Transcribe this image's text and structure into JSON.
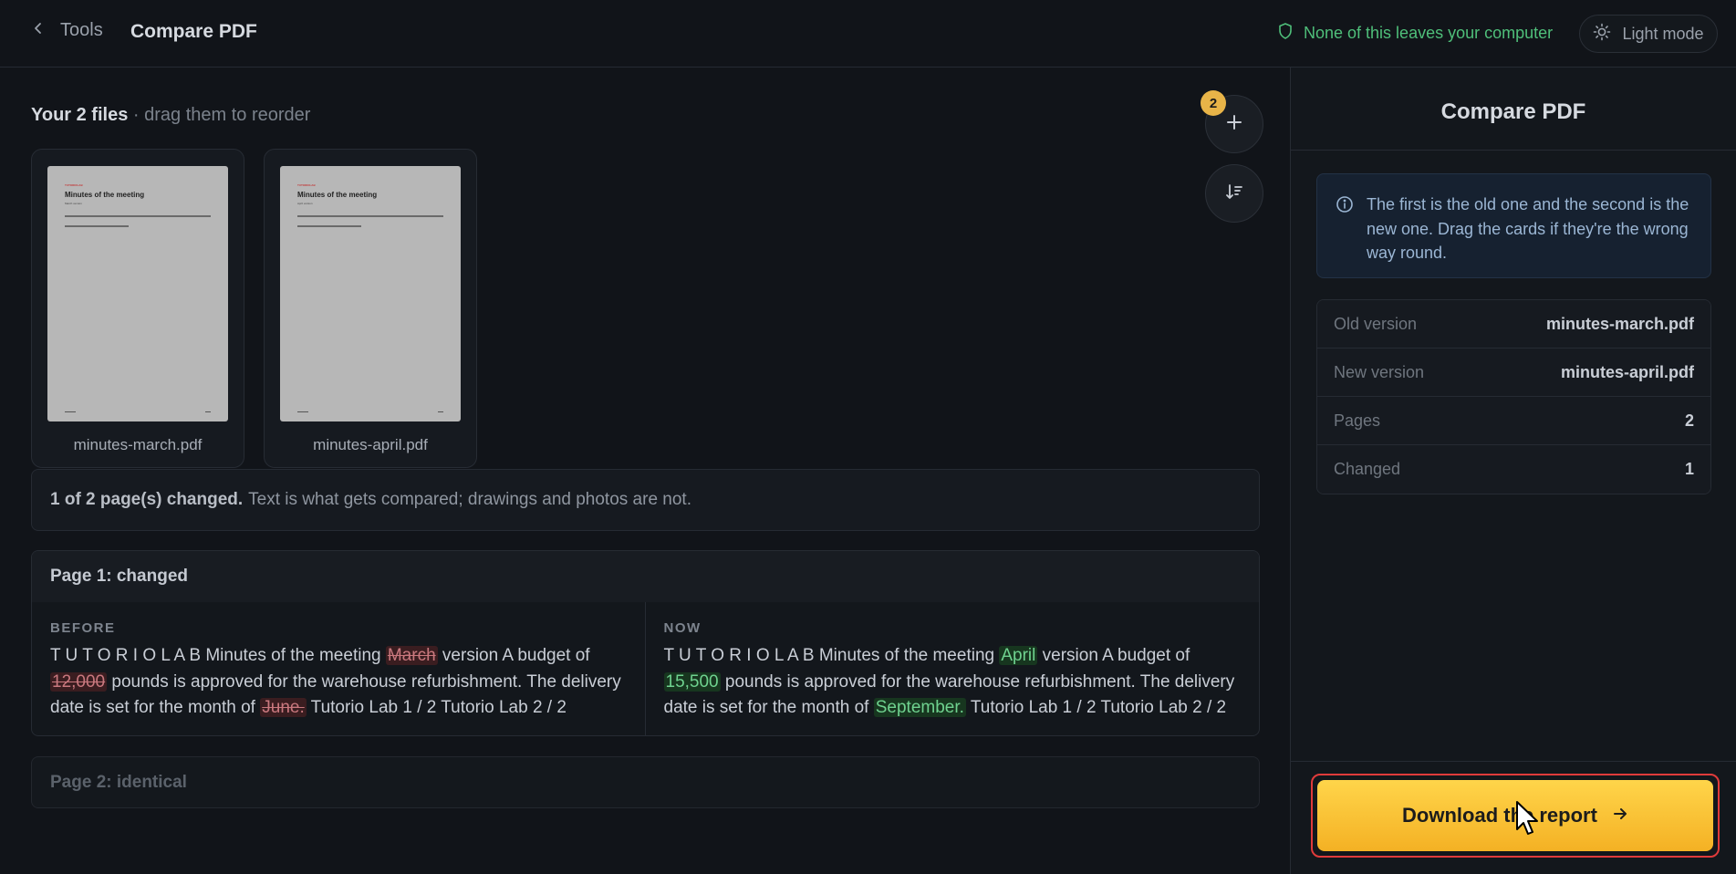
{
  "header": {
    "back_label": "Tools",
    "title": "Compare PDF",
    "privacy_note": "None of this leaves your computer",
    "theme_toggle_label": "Light mode"
  },
  "files": {
    "heading_strong": "Your 2 files",
    "heading_muted": " · drag them to reorder",
    "count_badge": "2",
    "items": [
      {
        "name": "minutes-march.pdf",
        "thumb_brand": "TUTORIOLAB",
        "thumb_title": "Minutes of the meeting",
        "thumb_sub": "March version"
      },
      {
        "name": "minutes-april.pdf",
        "thumb_brand": "TUTORIOLAB",
        "thumb_title": "Minutes of the meeting",
        "thumb_sub": "April version"
      }
    ]
  },
  "summary": {
    "strong": "1 of 2 page(s) changed.",
    "text": "Text is what gets compared; drawings and photos are not."
  },
  "page1": {
    "title": "Page 1: changed",
    "before_label": "BEFORE",
    "now_label": "NOW",
    "before": {
      "t1": "T U T O R I O L A B Minutes of the meeting ",
      "d1": "March",
      "t2": " version A budget of ",
      "d2": "12,000",
      "t3": " pounds is approved for the warehouse refurbishment. The delivery date is set for the month of ",
      "d3": "June.",
      "t4": " Tutorio Lab 1 / 2 Tutorio Lab 2 / 2"
    },
    "now": {
      "t1": "T U T O R I O L A B Minutes of the meeting ",
      "i1": "April",
      "t2": " version A budget of ",
      "i2": "15,500",
      "t3": " pounds is approved for the warehouse refurbishment. The delivery date is set for the month of ",
      "i3": "September.",
      "t4": " Tutorio Lab 1 / 2 Tutorio Lab 2 / 2"
    }
  },
  "page2": {
    "title": "Page 2: identical"
  },
  "sidebar": {
    "title": "Compare PDF",
    "info": "The first is the old one and the second is the new one. Drag the cards if they're the wrong way round.",
    "meta": [
      {
        "key": "Old version",
        "value": "minutes-march.pdf"
      },
      {
        "key": "New version",
        "value": "minutes-april.pdf"
      },
      {
        "key": "Pages",
        "value": "2"
      },
      {
        "key": "Changed",
        "value": "1"
      }
    ],
    "download_label": "Download the report"
  },
  "colors": {
    "accent": "#f4b124",
    "privacy_green": "#4fbf7a",
    "deleted": "#c9787e",
    "inserted": "#6fd28f",
    "highlight_border": "#e03b3b"
  }
}
